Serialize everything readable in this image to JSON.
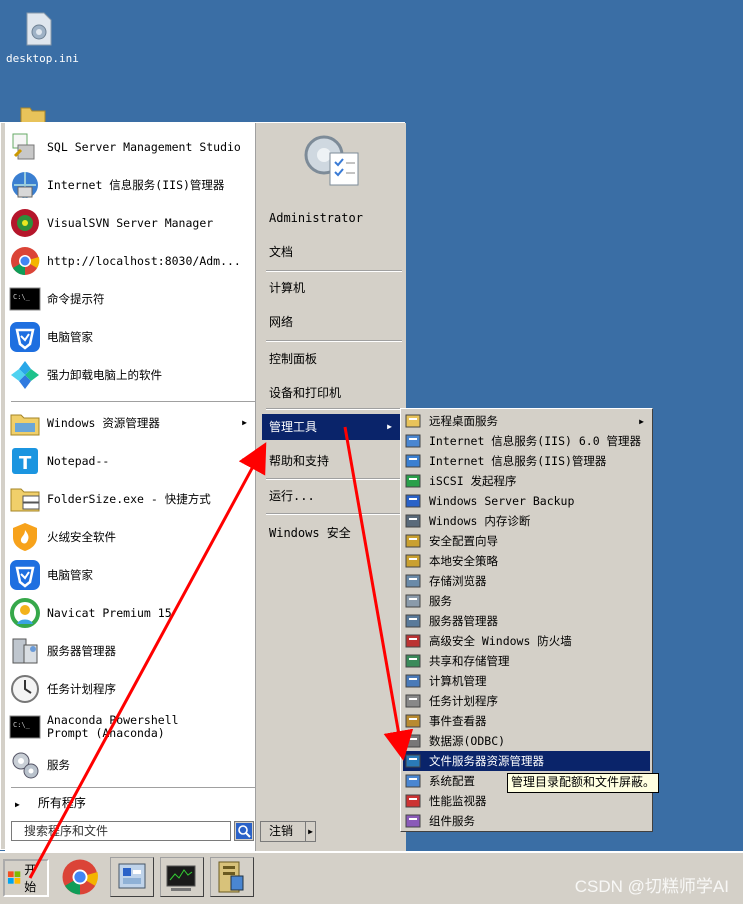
{
  "desktop": {
    "icon_label": "desktop.ini"
  },
  "start_menu": {
    "pinned": [
      {
        "label": "SQL Server Management Studio",
        "icon": "sql-server-icon"
      },
      {
        "label": "Internet 信息服务(IIS)管理器",
        "icon": "iis-manager-icon"
      },
      {
        "label": "VisualSVN Server Manager",
        "icon": "visualsvn-icon"
      },
      {
        "label": "http://localhost:8030/Adm...",
        "icon": "chrome-icon"
      },
      {
        "label": "命令提示符",
        "icon": "command-prompt-icon"
      },
      {
        "label": "电脑管家",
        "icon": "pc-manager-icon"
      },
      {
        "label": "强力卸载电脑上的软件",
        "icon": "uninstaller-icon"
      }
    ],
    "recent": [
      {
        "label": "Windows 资源管理器",
        "icon": "explorer-icon",
        "arrow": "▶"
      },
      {
        "label": "Notepad--",
        "icon": "notepad-icon",
        "arrow": "▶"
      },
      {
        "label": "FolderSize.exe - 快捷方式",
        "icon": "foldersize-icon"
      },
      {
        "label": "火绒安全软件",
        "icon": "huorong-icon"
      },
      {
        "label": "电脑管家",
        "icon": "pc-manager-icon"
      },
      {
        "label": "Navicat Premium 15",
        "icon": "navicat-icon"
      },
      {
        "label": "服务器管理器",
        "icon": "server-manager-icon"
      },
      {
        "label": "任务计划程序",
        "icon": "task-scheduler-icon"
      },
      {
        "label": "Anaconda Powershell Prompt (Anaconda)",
        "icon": "anaconda-prompt-icon"
      },
      {
        "label": "服务",
        "icon": "services-icon"
      }
    ],
    "all_programs": "所有程序",
    "search_placeholder": "搜索程序和文件",
    "right": {
      "user": "Administrator",
      "documents": "文档",
      "computer": "计算机",
      "network": "网络",
      "control_panel": "控制面板",
      "devices": "设备和打印机",
      "admin_tools": "管理工具",
      "help": "帮助和支持",
      "run": "运行...",
      "security": "Windows 安全",
      "arrow": "▶"
    },
    "logoff": "注销",
    "logoff_arrow": "▶"
  },
  "admin_submenu": {
    "items": [
      {
        "label": "远程桌面服务",
        "icon": "folder-icon",
        "arrow": "▶"
      },
      {
        "label": "Internet 信息服务(IIS) 6.0 管理器",
        "icon": "iis6-icon"
      },
      {
        "label": "Internet 信息服务(IIS)管理器",
        "icon": "iis-manager-icon"
      },
      {
        "label": "iSCSI 发起程序",
        "icon": "iscsi-icon"
      },
      {
        "label": "Windows Server Backup",
        "icon": "backup-icon"
      },
      {
        "label": "Windows 内存诊断",
        "icon": "memory-diagnostic-icon"
      },
      {
        "label": "安全配置向导",
        "icon": "security-wizard-icon"
      },
      {
        "label": "本地安全策略",
        "icon": "local-policy-icon"
      },
      {
        "label": "存储浏览器",
        "icon": "storage-explorer-icon"
      },
      {
        "label": "服务",
        "icon": "services-icon"
      },
      {
        "label": "服务器管理器",
        "icon": "server-manager-icon"
      },
      {
        "label": "高级安全 Windows 防火墙",
        "icon": "firewall-icon"
      },
      {
        "label": "共享和存储管理",
        "icon": "share-storage-icon"
      },
      {
        "label": "计算机管理",
        "icon": "computer-management-icon"
      },
      {
        "label": "任务计划程序",
        "icon": "task-scheduler-icon"
      },
      {
        "label": "事件查看器",
        "icon": "event-viewer-icon"
      },
      {
        "label": "数据源(ODBC)",
        "icon": "odbc-icon"
      },
      {
        "label": "文件服务器资源管理器",
        "icon": "fsrm-icon"
      },
      {
        "label": "系统配置",
        "icon": "msconfig-icon"
      },
      {
        "label": "性能监视器",
        "icon": "perfmon-icon"
      },
      {
        "label": "组件服务",
        "icon": "component-services-icon"
      }
    ],
    "tooltip": "管理目录配额和文件屏蔽。"
  },
  "taskbar": {
    "start_label": "开始",
    "buttons": [
      "chrome-icon",
      "server-manager-icon",
      "network-monitor-icon",
      "file-server-icon"
    ]
  },
  "watermark": "CSDN @切糕师学AI",
  "colors": {
    "desktop": "#3a6ea5",
    "menu_bg": "#d4d0c8",
    "highlight": "#0a246a",
    "arrow": "#ff0000",
    "tooltip_bg": "#ffffe1"
  }
}
